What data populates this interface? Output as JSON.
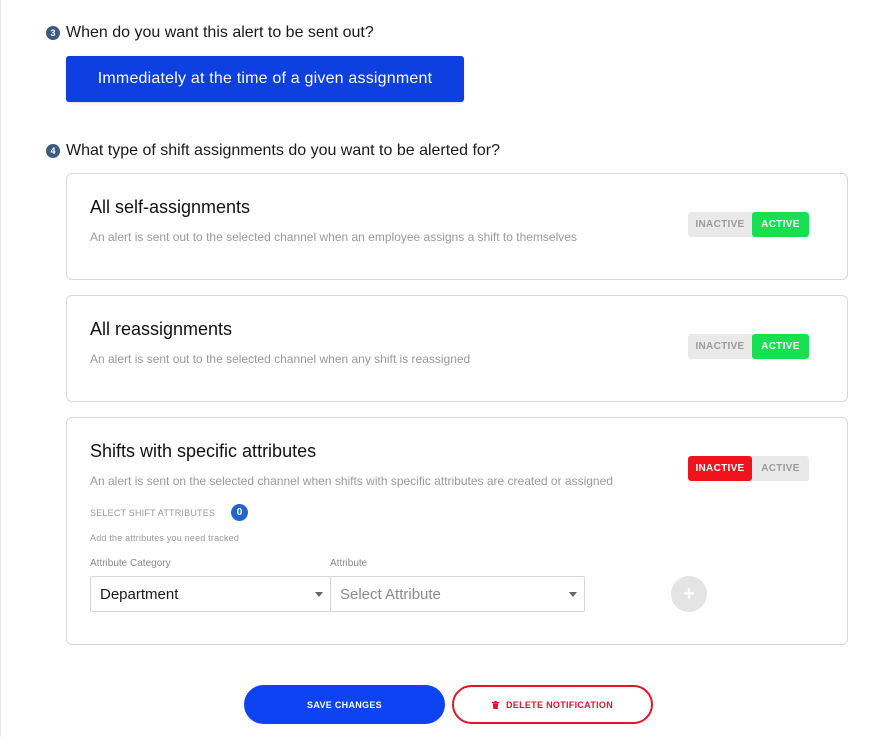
{
  "step3": {
    "number": "3",
    "question": "When do you want this alert to be sent out?",
    "selected_timing": "Immediately at the time of a given assignment"
  },
  "step4": {
    "number": "4",
    "question": "What type of shift assignments do you want to be alerted for?"
  },
  "cards": [
    {
      "title": "All self-assignments",
      "description": "An alert is sent out to the selected channel when an employee assigns a shift to themselves",
      "toggle": {
        "inactive_label": "INACTIVE",
        "active_label": "ACTIVE",
        "state": "active"
      }
    },
    {
      "title": "All reassignments",
      "description": "An alert is sent out to the selected channel when any shift is reassigned",
      "toggle": {
        "inactive_label": "INACTIVE",
        "active_label": "ACTIVE",
        "state": "active"
      }
    },
    {
      "title": "Shifts with specific attributes",
      "description": "An alert is sent on the selected channel when shifts with specific attributes are created or assigned",
      "toggle": {
        "inactive_label": "INACTIVE",
        "active_label": "ACTIVE",
        "state": "inactive"
      },
      "attributes": {
        "section_label": "SELECT SHIFT ATTRIBUTES",
        "count": "0",
        "hint": "Add the attributes you need tracked",
        "category_label": "Attribute Category",
        "category_value": "Department",
        "attribute_label": "Attribute",
        "attribute_placeholder": "Select Attribute",
        "add_symbol": "+"
      }
    }
  ],
  "actions": {
    "save_label": "SAVE CHANGES",
    "delete_label": "DELETE NOTIFICATION"
  },
  "colors": {
    "primary_blue": "#0e3fe0",
    "active_green": "#16e052",
    "inactive_red": "#f2121c",
    "delete_red": "#e0142a"
  }
}
